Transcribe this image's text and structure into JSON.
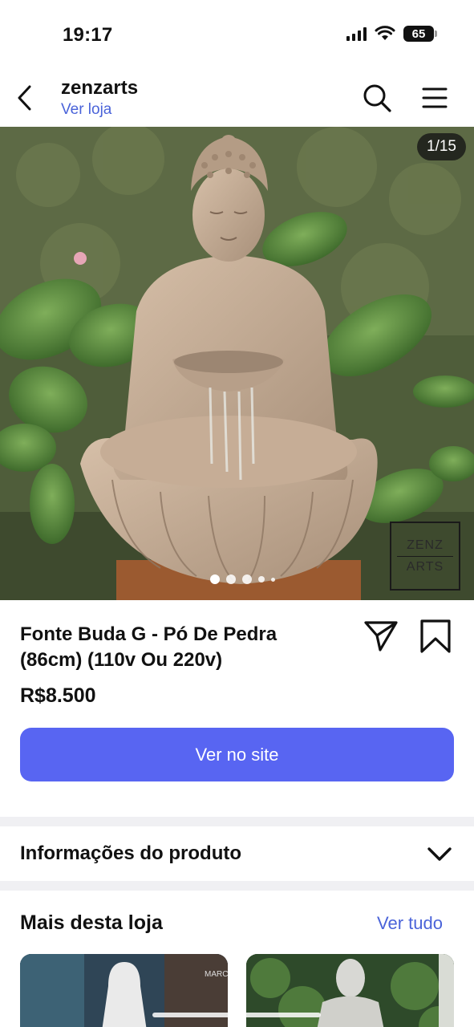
{
  "status_bar": {
    "time": "19:17",
    "battery": "65",
    "icons": [
      "signal-icon",
      "wifi-icon",
      "battery-icon"
    ]
  },
  "header": {
    "store_name": "zenzarts",
    "store_link": "Ver loja",
    "icons": [
      "back-icon",
      "search-icon",
      "menu-icon"
    ]
  },
  "gallery": {
    "counter": "1/15",
    "current_index": 1,
    "total": 15,
    "watermark_line1": "ZENZ",
    "watermark_line2": "ARTS"
  },
  "product": {
    "title": "Fonte Buda G - Pó De Pedra (86cm) (110v Ou 220v)",
    "price": "R$8.500",
    "cta_label": "Ver no site",
    "cta_color": "#5865f2"
  },
  "info_section": {
    "label": "Informações do produto"
  },
  "more_section": {
    "title": "Mais desta loja",
    "see_all": "Ver tudo",
    "thumb_text": "MARC"
  },
  "colors": {
    "accent_link": "#4a63d9",
    "button": "#5865f2"
  }
}
